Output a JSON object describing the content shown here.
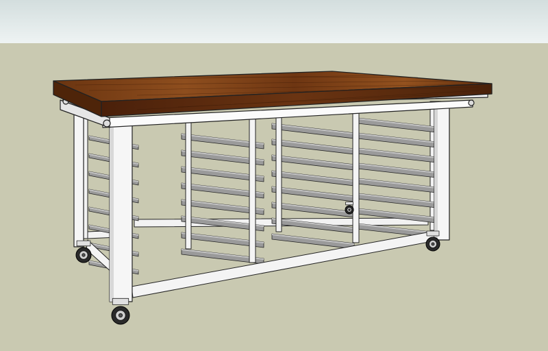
{
  "scene": {
    "subject": "rolling-bakers-table",
    "colors": {
      "sky_top": "#d3dede",
      "sky_bottom": "#eef3f3",
      "ground": "#c9c9b1",
      "wood_light": "#8a4a1c",
      "wood_dark": "#5a2a0c",
      "wood_edge": "#4a220a",
      "frame": "#f4f4f4",
      "frame_shadow": "#b8b8b8",
      "outline": "#222222",
      "shelf": "#9a9a9a",
      "shelf_light": "#c4c4c4",
      "caster": "#2a2a2a"
    },
    "rack_columns": 4,
    "slides_per_column": 8,
    "casters": 4,
    "icons": [
      "table-top-icon",
      "bakers-rack-icon",
      "caster-wheel-icon"
    ]
  }
}
